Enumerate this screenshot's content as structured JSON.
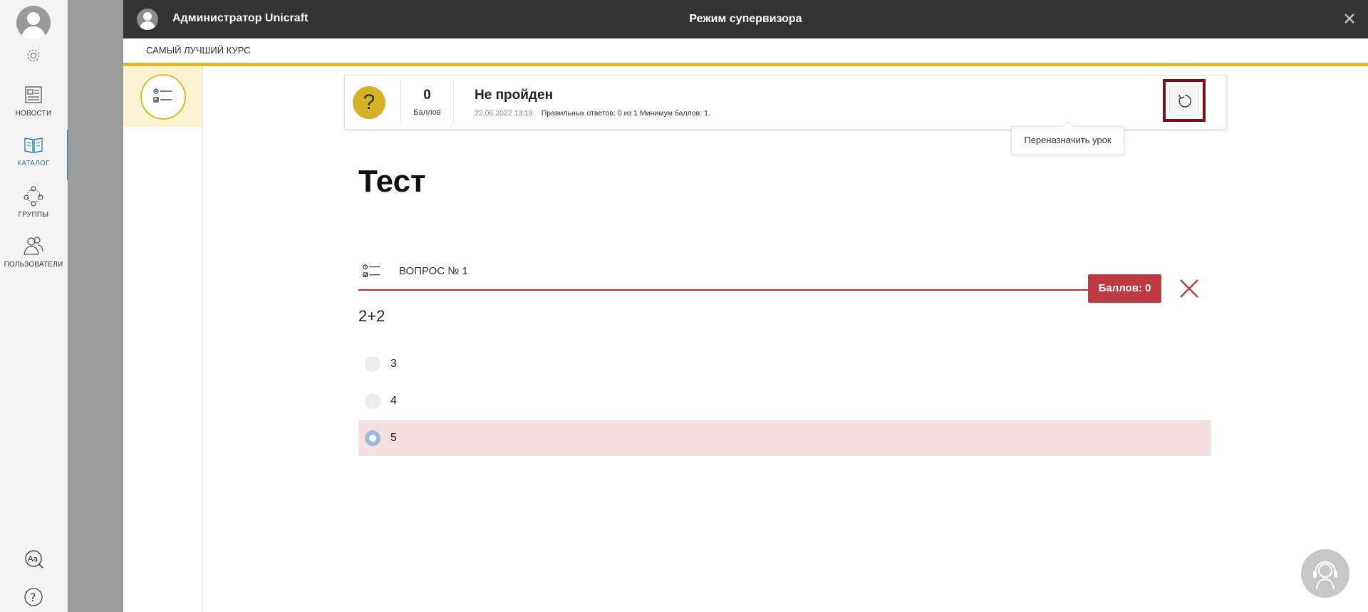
{
  "sidebar": {
    "items": [
      {
        "label": "НОВОСТИ",
        "icon": "newspaper-icon"
      },
      {
        "label": "КАТАЛОГ",
        "icon": "book-icon",
        "active": true
      },
      {
        "label": "ГРУППЫ",
        "icon": "groups-icon"
      },
      {
        "label": "ПОЛЬЗОВАТЕЛИ",
        "icon": "users-icon"
      }
    ],
    "bottom_icons": [
      "font-size-icon",
      "help-icon"
    ]
  },
  "header": {
    "user_name": "Администратор Unicraft",
    "mode_title": "Режим супервизора"
  },
  "course": {
    "title": "САМЫЙ ЛУЧШИЙ КУРС"
  },
  "result": {
    "score": "0",
    "score_label": "Баллов",
    "status": "Не пройден",
    "date": "22.06.2022 13:19",
    "details": "Правильных ответов: 0 из 1 Минимум баллов: 1.",
    "reassign_tooltip": "Переназначить урок"
  },
  "lesson": {
    "title": "Тест"
  },
  "question": {
    "label": "ВОПРОС № 1",
    "points": "Баллов: 0",
    "text": "2+2",
    "options": [
      {
        "text": "3",
        "selected": false
      },
      {
        "text": "4",
        "selected": false
      },
      {
        "text": "5",
        "selected": true
      }
    ]
  },
  "colors": {
    "accent": "#e0b92a",
    "error": "#bf3a40",
    "header_bg": "#333333",
    "active_nav": "#2f7fc1"
  }
}
